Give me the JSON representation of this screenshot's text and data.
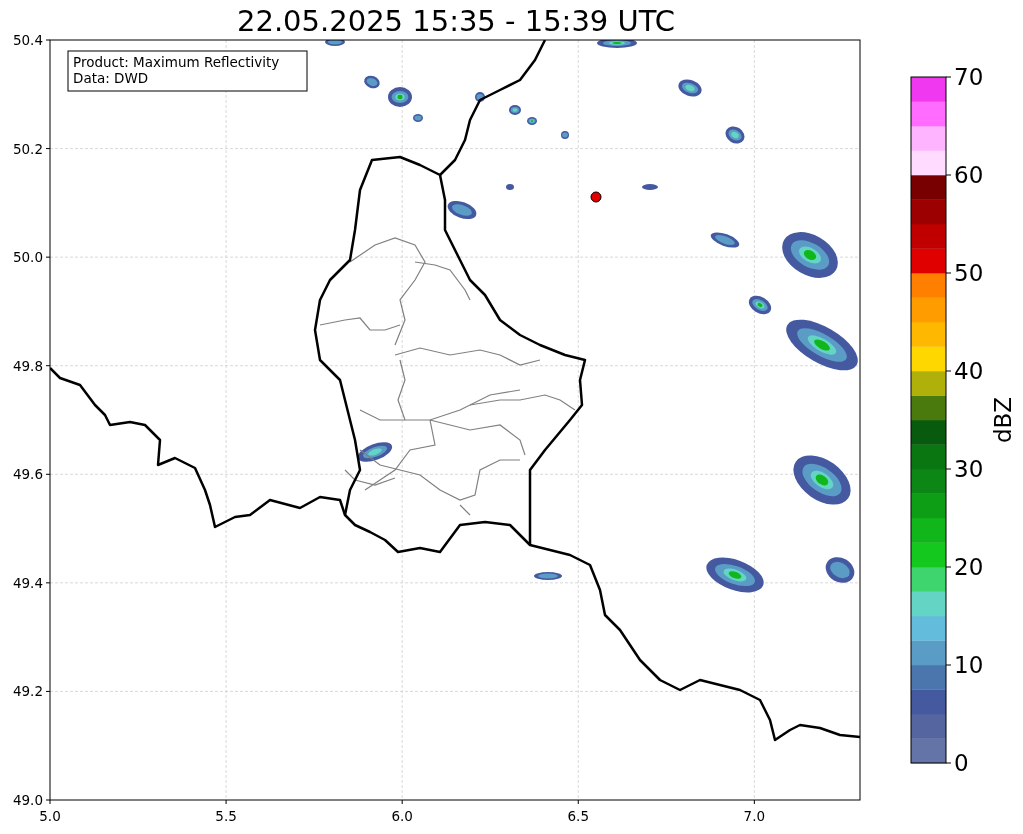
{
  "title": "22.05.2025 15:35 - 15:39 UTC",
  "info_box": [
    "Product: Maximum Reflectivity",
    "Data: DWD"
  ],
  "map": {
    "x_ticks": [
      "5.0",
      "5.5",
      "6.0",
      "6.5",
      "7.0"
    ],
    "y_ticks": [
      "50.4",
      "50.2",
      "50.0",
      "49.8",
      "49.6",
      "49.4",
      "49.2",
      "49.0"
    ]
  },
  "colorbar": {
    "label": "dBZ",
    "ticks": [
      "70",
      "60",
      "50",
      "40",
      "30",
      "20",
      "10",
      "0"
    ],
    "bands": [
      {
        "color": "#6474a6"
      },
      {
        "color": "#55659f"
      },
      {
        "color": "#4459a0"
      },
      {
        "color": "#4a76ad"
      },
      {
        "color": "#5b9cc6"
      },
      {
        "color": "#64bcdc"
      },
      {
        "color": "#64d4c4"
      },
      {
        "color": "#3ed46e"
      },
      {
        "color": "#14c81e"
      },
      {
        "color": "#10b61a"
      },
      {
        "color": "#0e9e16"
      },
      {
        "color": "#0c8614"
      },
      {
        "color": "#0a7612"
      },
      {
        "color": "#085a0e"
      },
      {
        "color": "#4a7a0e"
      },
      {
        "color": "#b0b00a"
      },
      {
        "color": "#ffd700"
      },
      {
        "color": "#ffb800"
      },
      {
        "color": "#ff9c00"
      },
      {
        "color": "#ff7f00"
      },
      {
        "color": "#e00000"
      },
      {
        "color": "#c00000"
      },
      {
        "color": "#9c0000"
      },
      {
        "color": "#780000"
      },
      {
        "color": "#ffdcff"
      },
      {
        "color": "#ffb4ff"
      },
      {
        "color": "#ff6cff"
      },
      {
        "color": "#f038f0"
      }
    ]
  }
}
